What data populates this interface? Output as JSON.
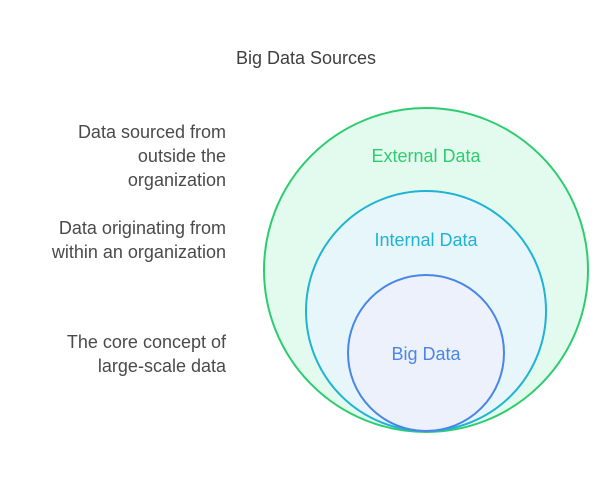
{
  "title": "Big Data Sources",
  "descriptions": [
    "Data sourced from\noutside the\norganization",
    "Data originating from\nwithin an organization",
    "The core concept of\nlarge-scale data"
  ],
  "circles": [
    {
      "label": "External Data",
      "stroke": "#2ecc71",
      "fill": "#e3fbee",
      "text_color": "#2ecc71"
    },
    {
      "label": "Internal Data",
      "stroke": "#1fb3d4",
      "fill": "#e6f6fb",
      "text_color": "#1fb3d4"
    },
    {
      "label": "Big Data",
      "stroke": "#4a86e8",
      "fill": "#edf1fb",
      "text_color": "#4a86e8"
    }
  ]
}
